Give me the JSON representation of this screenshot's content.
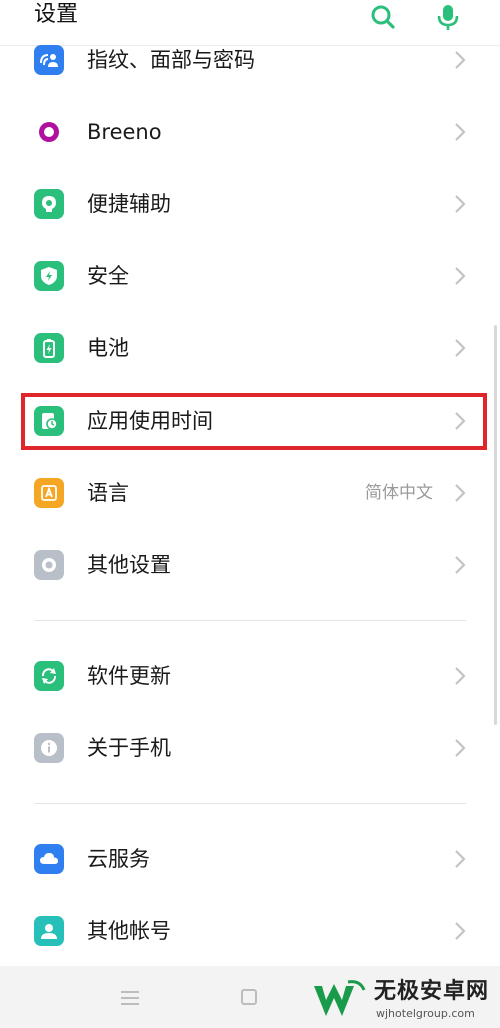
{
  "header": {
    "title": "设置",
    "search_icon": "search-icon",
    "mic_icon": "microphone-icon",
    "accent": "#2bbf7c"
  },
  "items": [
    {
      "label": "指纹、面部与密码",
      "icon": "fingerprint-face-icon",
      "color": "#2f7ff0"
    },
    {
      "label": "Breeno",
      "icon": "breeno-icon",
      "color": "#b0109e"
    },
    {
      "label": "便捷辅助",
      "icon": "assist-icon",
      "color": "#2bbf7c"
    },
    {
      "label": "安全",
      "icon": "shield-icon",
      "color": "#2bbf7c"
    },
    {
      "label": "电池",
      "icon": "battery-icon",
      "color": "#2bbf7c"
    },
    {
      "label": "应用使用时间",
      "icon": "app-usage-time-icon",
      "color": "#2bbf7c"
    },
    {
      "label": "语言",
      "value": "简体中文",
      "icon": "language-icon",
      "color": "#f5a623"
    },
    {
      "label": "其他设置",
      "icon": "other-settings-icon",
      "color": "#b8bfc8"
    },
    {
      "label": "软件更新",
      "icon": "software-update-icon",
      "color": "#2bbf7c"
    },
    {
      "label": "关于手机",
      "icon": "info-icon",
      "color": "#b8bfc8"
    },
    {
      "label": "云服务",
      "icon": "cloud-icon",
      "color": "#2f7ff0"
    },
    {
      "label": "其他帐号",
      "icon": "account-icon",
      "color": "#26c0b8"
    }
  ],
  "highlight_color": "#e0262b",
  "watermark": {
    "text": "无极安卓网",
    "url": "wjhotelgroup.com"
  },
  "navbar": {
    "menu_icon": "menu-icon",
    "home_icon": "home-square-icon"
  }
}
